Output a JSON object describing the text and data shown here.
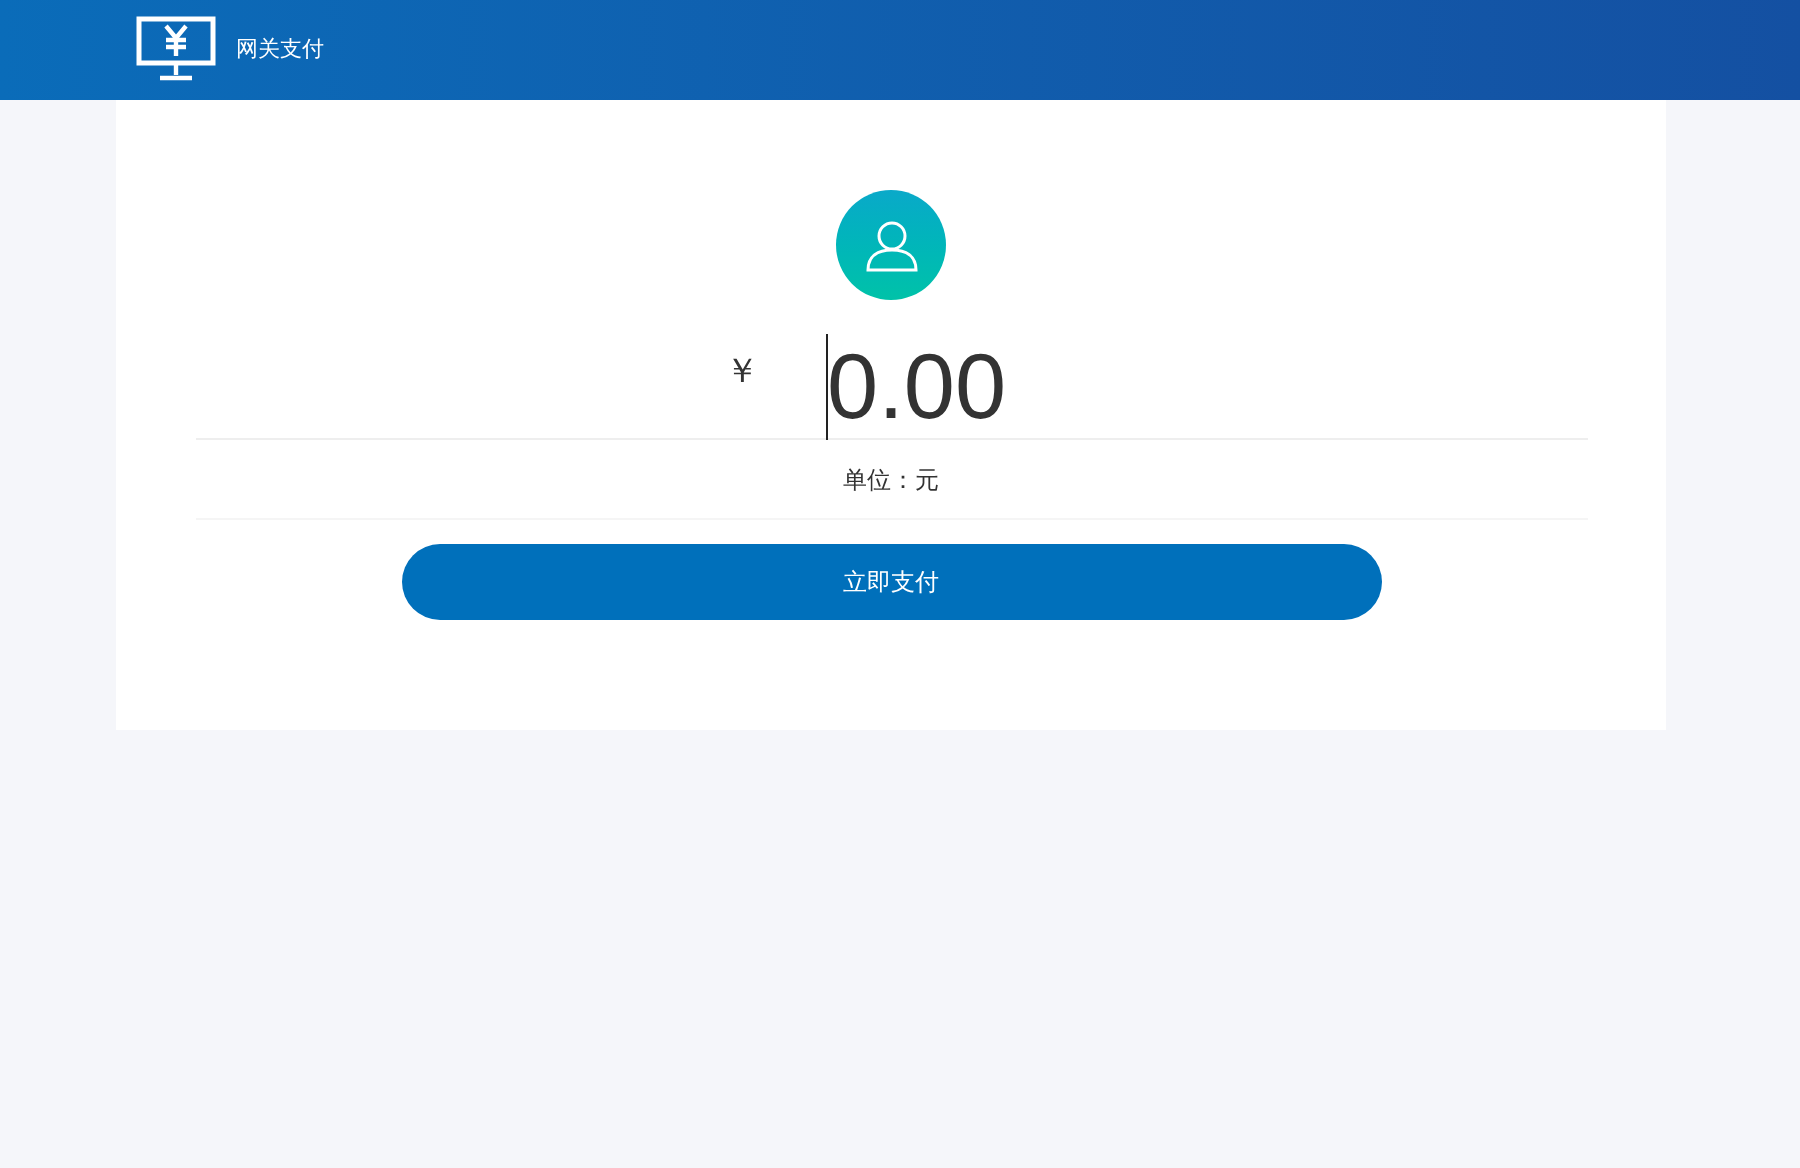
{
  "header": {
    "title": "网关支付"
  },
  "amount": {
    "currency": "￥",
    "value": "0.00",
    "unit": "单位：元"
  },
  "pay_button": {
    "label": "立即支付"
  }
}
